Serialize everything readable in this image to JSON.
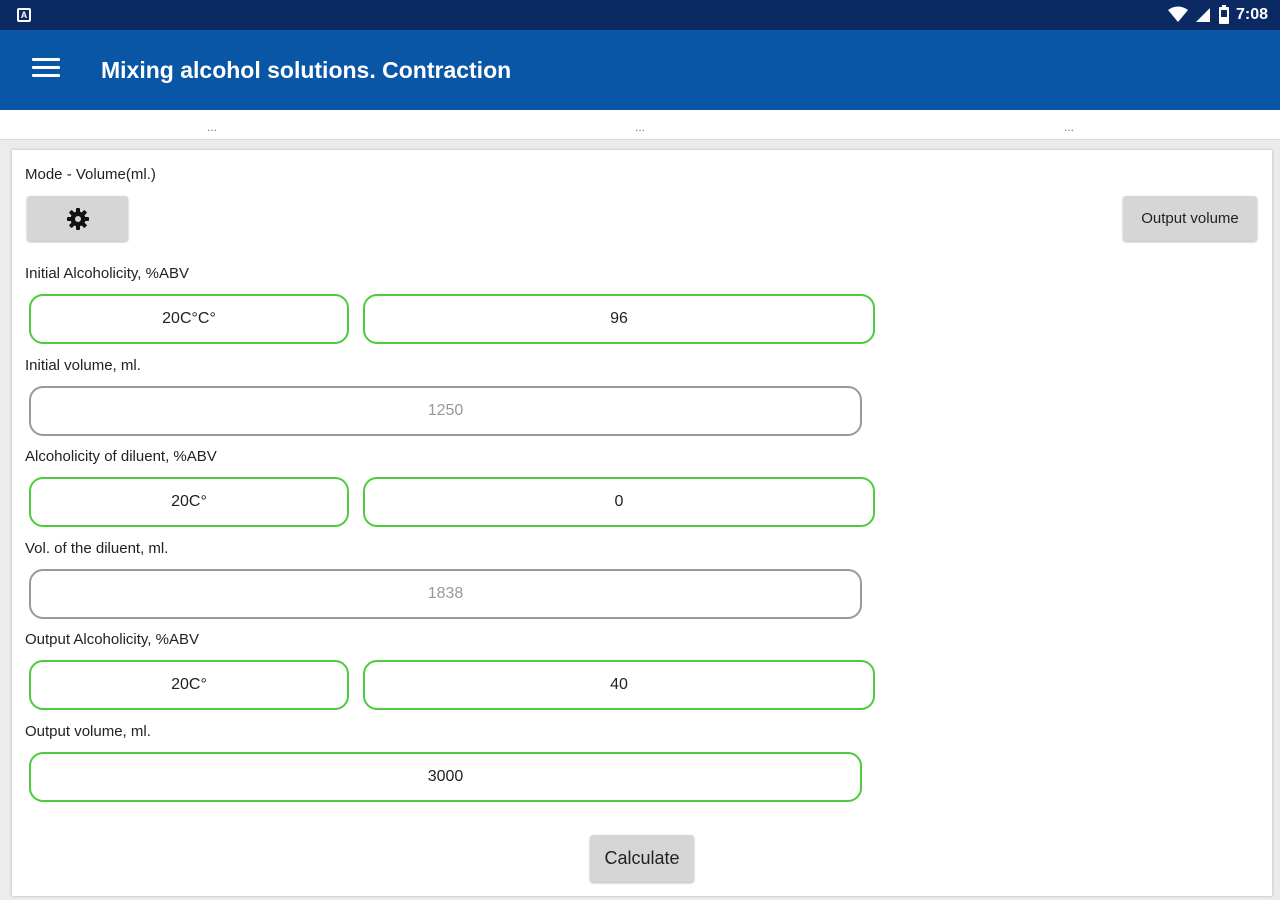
{
  "status_bar": {
    "time": "7:08"
  },
  "app_bar": {
    "title": "Mixing alcohol solutions. Contraction"
  },
  "dots_row": [
    "...",
    "...",
    "..."
  ],
  "form": {
    "mode_label": "Mode - Volume(ml.)",
    "output_volume_button": "Output volume",
    "initial_alcoholicity": {
      "label": "Initial Alcoholicity, %ABV",
      "temp": "20C°C°",
      "value": "96"
    },
    "initial_volume": {
      "label": "Initial volume, ml.",
      "value": "1250"
    },
    "diluent_alcoholicity": {
      "label": "Alcoholicity of diluent, %ABV",
      "temp": "20C°",
      "value": "0"
    },
    "diluent_volume": {
      "label": "Vol. of the diluent, ml.",
      "value": "1838"
    },
    "output_alcoholicity": {
      "label": "Output  Alcoholicity, %ABV",
      "temp": "20C°",
      "value": "40"
    },
    "output_volume": {
      "label": "Output volume, ml.",
      "value": "3000"
    },
    "calculate_button": "Calculate"
  },
  "colors": {
    "status_bar": "#0b2a63",
    "app_bar": "#0a56a6",
    "field_active_border": "#4ccc3c",
    "field_readonly_border": "#9a9a9a"
  },
  "icons": [
    "notification-icon",
    "wifi-icon",
    "cell-signal-icon",
    "battery-icon",
    "menu-icon",
    "gear-icon"
  ]
}
